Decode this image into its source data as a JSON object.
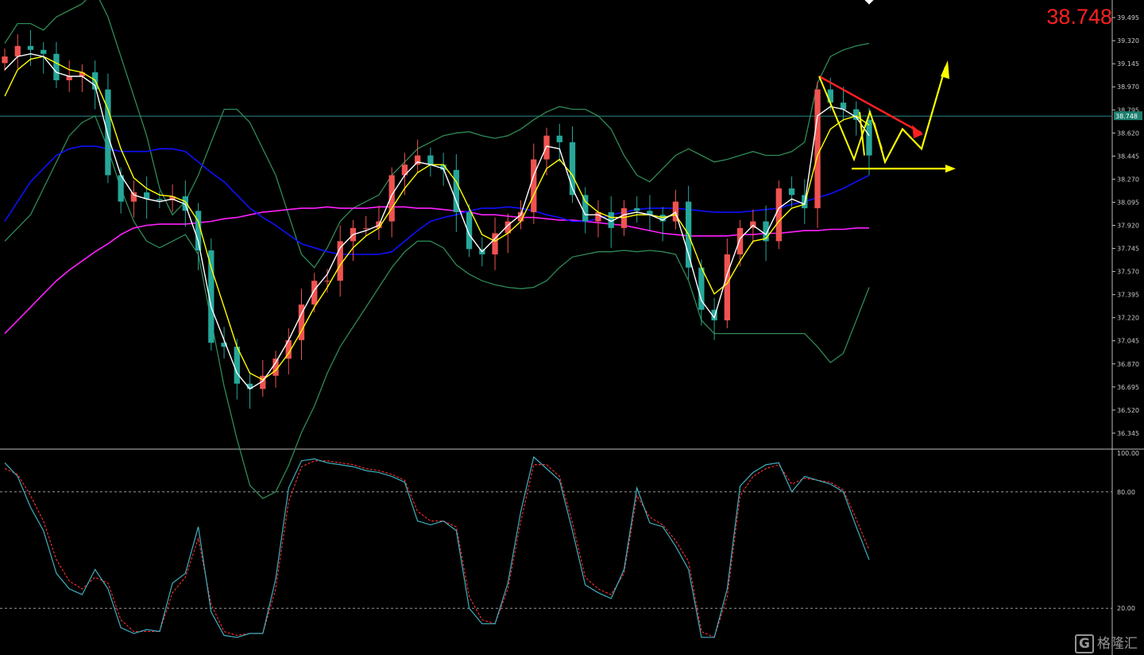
{
  "price_readout": "38.748",
  "current_price_label": "38.748",
  "watermark": "格隆汇",
  "watermark_icon": "g-logo-icon",
  "colors": {
    "background": "#000000",
    "candle_up": "#ef5350",
    "candle_down": "#26a69a",
    "ma_fast": "#ffffff",
    "ma_mid": "#ffff00",
    "ma_long_blue": "#1010ff",
    "ma_long_magenta": "#ff20ff",
    "bollinger": "#2e8b57",
    "annotation_red": "#ff2020",
    "annotation_yellow": "#ffff00",
    "stoch_main": "#40b0c0",
    "stoch_signal": "#ff3030",
    "grid_text": "#c8c8c8",
    "price_line": "#2e8b8b"
  },
  "chart_data": [
    {
      "type": "candlestick",
      "title": "",
      "y_ticks": [
        "39.495",
        "39.320",
        "39.145",
        "38.970",
        "38.795",
        "38.620",
        "38.445",
        "38.270",
        "38.095",
        "37.920",
        "37.745",
        "37.570",
        "37.395",
        "37.220",
        "37.045",
        "36.870",
        "36.695",
        "36.520",
        "36.345"
      ],
      "ylim": [
        36.23,
        39.58
      ],
      "current_price": 38.748,
      "close_series": [
        39.2,
        39.28,
        39.25,
        39.22,
        39.02,
        39.05,
        39.08,
        38.95,
        38.3,
        38.1,
        38.17,
        38.12,
        38.11,
        38.14,
        38.03,
        37.73,
        37.03,
        37.0,
        36.72,
        36.68,
        36.78,
        36.91,
        37.05,
        37.32,
        37.5,
        37.5,
        37.8,
        37.9,
        37.9,
        37.95,
        38.3,
        38.38,
        38.45,
        38.38,
        38.34,
        38.02,
        37.74,
        37.7,
        37.86,
        37.95,
        38.02,
        38.42,
        38.6,
        38.55,
        38.15,
        37.95,
        38.02,
        37.9,
        38.05,
        38.03,
        38.0,
        37.95,
        38.1,
        37.6,
        37.28,
        37.2,
        37.7,
        37.9,
        37.95,
        37.8,
        38.2,
        38.15,
        38.05,
        38.95,
        38.85,
        38.8,
        38.72,
        38.45
      ],
      "ma_fast_series": [
        39.1,
        39.2,
        39.22,
        39.2,
        39.08,
        39.05,
        39.05,
        38.98,
        38.6,
        38.3,
        38.15,
        38.12,
        38.1,
        38.12,
        38.08,
        37.8,
        37.3,
        37.05,
        36.8,
        36.68,
        36.74,
        36.88,
        37.05,
        37.25,
        37.43,
        37.55,
        37.75,
        37.85,
        37.88,
        37.92,
        38.15,
        38.3,
        38.4,
        38.38,
        38.35,
        38.1,
        37.85,
        37.72,
        37.82,
        37.92,
        38.0,
        38.3,
        38.52,
        38.5,
        38.2,
        38.0,
        38.0,
        37.95,
        38.0,
        38.02,
        38.0,
        37.96,
        38.02,
        37.7,
        37.35,
        37.22,
        37.55,
        37.82,
        37.92,
        37.85,
        38.05,
        38.12,
        38.08,
        38.75,
        38.82,
        38.8,
        38.74,
        38.6
      ],
      "ma_mid_series": [
        38.9,
        39.1,
        39.18,
        39.2,
        39.15,
        39.1,
        39.08,
        39.02,
        38.8,
        38.5,
        38.28,
        38.2,
        38.15,
        38.14,
        38.1,
        37.95,
        37.6,
        37.3,
        37.0,
        36.8,
        36.75,
        36.82,
        36.95,
        37.12,
        37.3,
        37.45,
        37.62,
        37.75,
        37.84,
        37.9,
        38.05,
        38.2,
        38.32,
        38.38,
        38.38,
        38.25,
        38.05,
        37.85,
        37.8,
        37.86,
        37.95,
        38.15,
        38.35,
        38.42,
        38.3,
        38.1,
        38.02,
        37.98,
        37.98,
        38.0,
        38.0,
        37.98,
        38.0,
        37.85,
        37.6,
        37.4,
        37.48,
        37.65,
        37.8,
        37.82,
        37.95,
        38.05,
        38.08,
        38.45,
        38.65,
        38.72,
        38.75,
        38.68
      ],
      "bb_upper_series": [
        39.3,
        39.45,
        39.45,
        39.4,
        39.5,
        39.55,
        39.6,
        39.7,
        39.5,
        39.2,
        38.9,
        38.6,
        38.2,
        38.0,
        38.1,
        38.3,
        38.55,
        38.8,
        38.8,
        38.7,
        38.5,
        38.3,
        38.0,
        37.7,
        37.6,
        37.75,
        37.95,
        38.05,
        38.1,
        38.15,
        38.3,
        38.4,
        38.5,
        38.55,
        38.6,
        38.62,
        38.63,
        38.6,
        38.58,
        38.6,
        38.65,
        38.72,
        38.78,
        38.82,
        38.8,
        38.8,
        38.75,
        38.65,
        38.45,
        38.3,
        38.25,
        38.35,
        38.45,
        38.5,
        38.45,
        38.4,
        38.42,
        38.45,
        38.48,
        38.45,
        38.45,
        38.48,
        38.55,
        39.0,
        39.2,
        39.25,
        39.28,
        39.3
      ],
      "bb_lower_series": [
        37.8,
        37.9,
        38.0,
        38.2,
        38.4,
        38.6,
        38.7,
        38.75,
        38.5,
        38.2,
        37.95,
        37.8,
        37.75,
        37.8,
        37.85,
        37.7,
        37.2,
        36.7,
        36.3,
        35.95,
        35.85,
        35.9,
        36.1,
        36.35,
        36.55,
        36.8,
        37.0,
        37.15,
        37.3,
        37.45,
        37.6,
        37.72,
        37.8,
        37.8,
        37.75,
        37.62,
        37.55,
        37.5,
        37.47,
        37.45,
        37.44,
        37.45,
        37.5,
        37.6,
        37.68,
        37.7,
        37.72,
        37.72,
        37.73,
        37.72,
        37.73,
        37.72,
        37.7,
        37.5,
        37.2,
        37.1,
        37.1,
        37.1,
        37.1,
        37.1,
        37.1,
        37.1,
        37.1,
        37.0,
        36.88,
        36.95,
        37.2,
        37.45
      ],
      "ma_blue_series": [
        37.95,
        38.1,
        38.25,
        38.35,
        38.45,
        38.5,
        38.52,
        38.52,
        38.5,
        38.48,
        38.48,
        38.48,
        38.5,
        38.5,
        38.48,
        38.4,
        38.32,
        38.25,
        38.15,
        38.05,
        37.98,
        37.92,
        37.85,
        37.78,
        37.75,
        37.72,
        37.7,
        37.7,
        37.7,
        37.7,
        37.72,
        37.8,
        37.88,
        37.95,
        37.98,
        38.0,
        38.03,
        38.05,
        38.05,
        38.06,
        38.05,
        38.03,
        38.0,
        37.98,
        37.95,
        37.95,
        37.97,
        38.0,
        38.02,
        38.04,
        38.05,
        38.05,
        38.05,
        38.04,
        38.03,
        38.02,
        38.02,
        38.02,
        38.03,
        38.04,
        38.05,
        38.08,
        38.1,
        38.13,
        38.16,
        38.2,
        38.25,
        38.3
      ],
      "ma_magenta_series": [
        37.1,
        37.2,
        37.3,
        37.4,
        37.5,
        37.58,
        37.65,
        37.72,
        37.78,
        37.85,
        37.9,
        37.92,
        37.93,
        37.93,
        37.93,
        37.94,
        37.95,
        37.97,
        37.98,
        38.0,
        38.02,
        38.03,
        38.04,
        38.05,
        38.05,
        38.06,
        38.05,
        38.05,
        38.05,
        38.06,
        38.06,
        38.06,
        38.05,
        38.05,
        38.04,
        38.03,
        38.02,
        38.0,
        38.0,
        37.99,
        37.98,
        37.98,
        37.97,
        37.96,
        37.96,
        37.95,
        37.94,
        37.93,
        37.92,
        37.9,
        37.88,
        37.86,
        37.85,
        37.84,
        37.84,
        37.84,
        37.84,
        37.85,
        37.85,
        37.86,
        37.86,
        37.87,
        37.88,
        37.88,
        37.89,
        37.89,
        37.9,
        37.9
      ]
    },
    {
      "type": "line",
      "title": "",
      "y_ticks": [
        "100.00",
        "80.00",
        "20.00"
      ],
      "ylim": [
        0,
        100
      ],
      "levels": [
        80,
        20
      ],
      "series": [
        {
          "values": [
            95,
            88,
            72,
            60,
            38,
            30,
            27,
            40,
            30,
            10,
            7,
            9,
            8,
            33,
            38,
            62,
            18,
            6,
            5,
            7,
            7,
            35,
            82,
            96,
            97,
            95,
            94,
            93,
            91,
            90,
            88,
            85,
            65,
            63,
            65,
            60,
            20,
            12,
            12,
            33,
            70,
            98,
            92,
            86,
            60,
            32,
            28,
            25,
            40,
            82,
            64,
            62,
            52,
            40,
            5,
            5,
            30,
            83,
            90,
            94,
            95,
            80,
            88,
            86,
            84,
            80,
            62,
            45
          ]
        },
        {
          "values": [
            92,
            89,
            78,
            65,
            45,
            34,
            30,
            36,
            33,
            14,
            8,
            8,
            8,
            28,
            36,
            56,
            22,
            8,
            6,
            7,
            7,
            30,
            75,
            93,
            96,
            96,
            95,
            94,
            92,
            91,
            89,
            86,
            70,
            65,
            65,
            62,
            26,
            14,
            12,
            30,
            65,
            94,
            94,
            88,
            64,
            36,
            30,
            27,
            38,
            78,
            67,
            63,
            55,
            44,
            8,
            5,
            26,
            78,
            88,
            92,
            94,
            84,
            87,
            86,
            85,
            81,
            66,
            50
          ]
        }
      ]
    }
  ]
}
